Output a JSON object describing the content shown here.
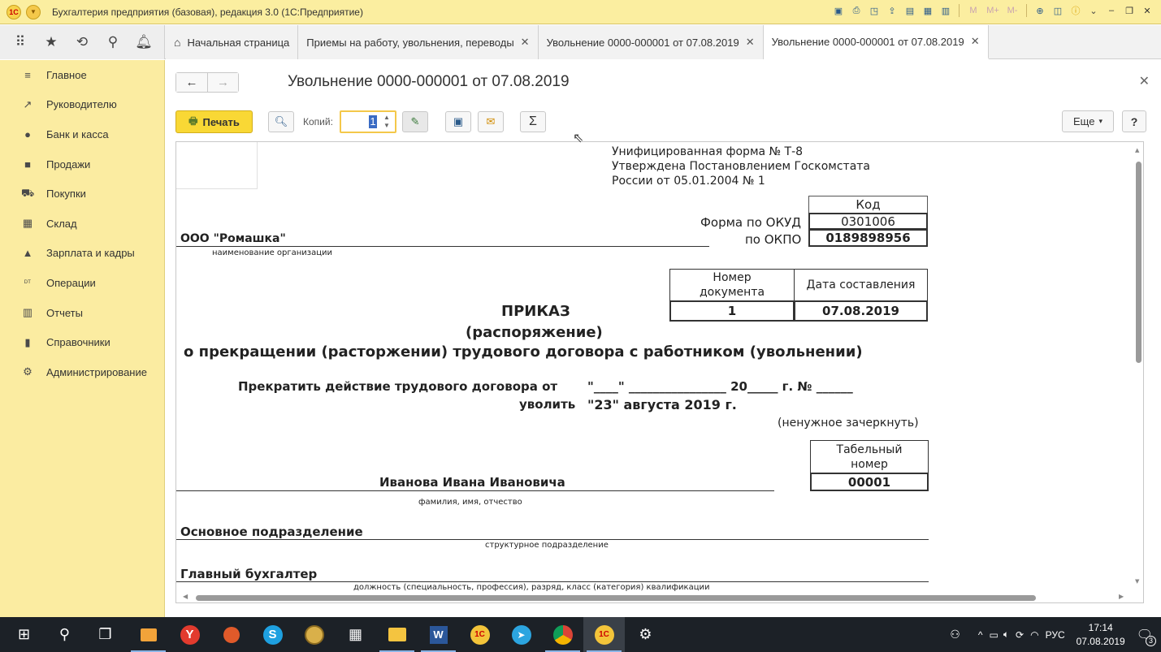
{
  "app": {
    "title": "Бухгалтерия предприятия (базовая), редакция 3.0  (1С:Предприятие)"
  },
  "tabs": [
    {
      "label": "Начальная страница"
    },
    {
      "label": "Приемы на работу, увольнения, переводы"
    },
    {
      "label": "Увольнение 0000-000001 от 07.08.2019"
    },
    {
      "label": "Увольнение 0000-000001 от 07.08.2019"
    }
  ],
  "sidebar": {
    "items": [
      {
        "label": "Главное",
        "icon": "menu-icon"
      },
      {
        "label": "Руководителю",
        "icon": "chart-trend-icon"
      },
      {
        "label": "Банк и касса",
        "icon": "bank-icon"
      },
      {
        "label": "Продажи",
        "icon": "bag-icon"
      },
      {
        "label": "Покупки",
        "icon": "cart-icon"
      },
      {
        "label": "Склад",
        "icon": "warehouse-icon"
      },
      {
        "label": "Зарплата и кадры",
        "icon": "person-icon"
      },
      {
        "label": "Операции",
        "icon": "dt-kt-icon"
      },
      {
        "label": "Отчеты",
        "icon": "bar-chart-icon"
      },
      {
        "label": "Справочники",
        "icon": "books-icon"
      },
      {
        "label": "Администрирование",
        "icon": "gear-icon"
      }
    ]
  },
  "form": {
    "title": "Увольнение 0000-000001 от 07.08.2019",
    "print_label": "Печать",
    "copies_label": "Копий:",
    "copies_value": "1",
    "more_label": "Еще",
    "help_label": "?"
  },
  "doc": {
    "header_line1": "Унифицированная форма № Т-8",
    "header_line2": "Утверждена Постановлением Госкомстата",
    "header_line3": "России от 05.01.2004 № 1",
    "code_header": "Код",
    "okud_label": "Форма по ОКУД",
    "okud_value": "0301006",
    "okpo_label": "по ОКПО",
    "okpo_value": "0189898956",
    "org_name": "ООО \"Ромашка\"",
    "org_caption": "наименование организации",
    "doc_number_header": "Номер документа",
    "doc_date_header": "Дата составления",
    "doc_number": "1",
    "doc_date": "07.08.2019",
    "title1": "ПРИКАЗ",
    "title2": "(распоряжение)",
    "title3": "о прекращении (расторжении) трудового договора с работником (увольнении)",
    "terminate_line": "Прекратить действие трудового договора от",
    "terminate_date": "\"____\" ________________ 20_____ г. № ______",
    "dismiss_label": "уволить",
    "dismiss_date": "\"23\" августа 2019 г.",
    "strike_note": "(ненужное зачеркнуть)",
    "tab_number_header": "Табельный номер",
    "tab_number": "00001",
    "employee_name": "Иванова Ивана Ивановича",
    "employee_caption": "фамилия, имя, отчество",
    "department": "Основное подразделение",
    "department_caption": "структурное подразделение",
    "position": "Главный бухгалтер",
    "position_caption": "должность (специальность, профессия), разряд, класс (категория) квалификации"
  },
  "taskbar": {
    "lang": "РУС",
    "time": "17:14",
    "date": "07.08.2019",
    "notifications": "3"
  }
}
